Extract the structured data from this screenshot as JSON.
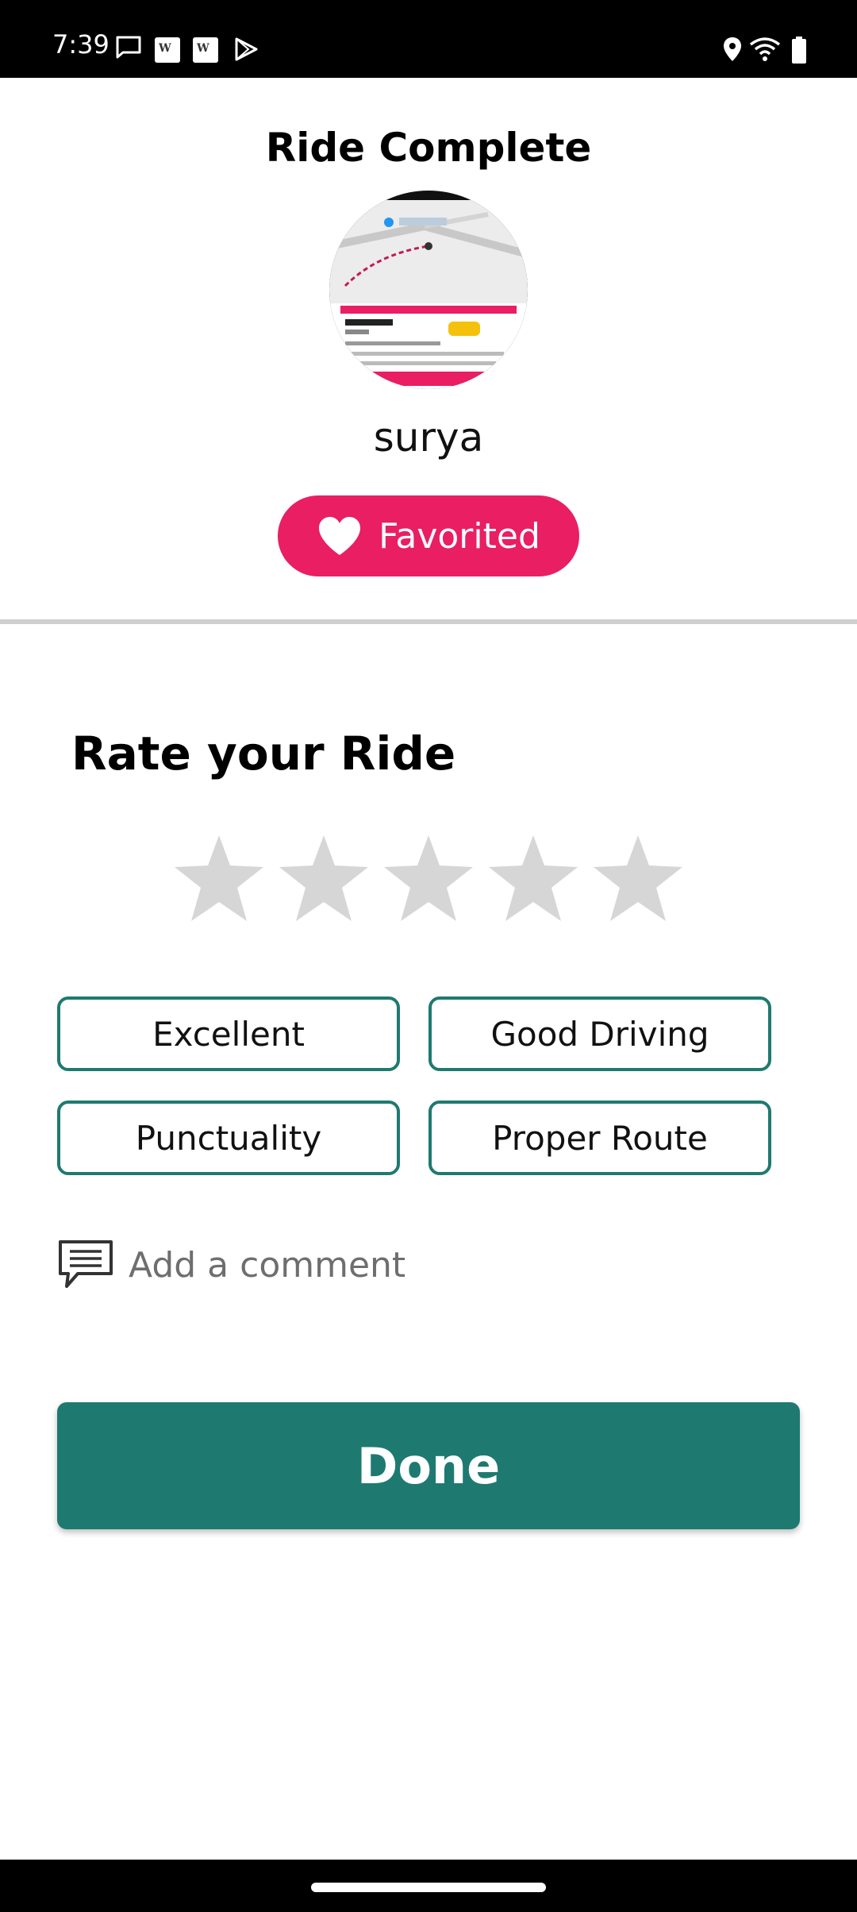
{
  "status_bar": {
    "time": "7:39",
    "icons": [
      "chat-icon",
      "news-icon",
      "news-icon",
      "play-store-icon",
      "location-icon",
      "wifi-icon",
      "battery-icon"
    ],
    "news_glyph": "W"
  },
  "header": {
    "title": "Ride Complete",
    "driver_name": "surya",
    "favorite_button_label": "Favorited"
  },
  "rating": {
    "title": "Rate your Ride",
    "stars_total": 5,
    "stars_selected": 0,
    "tags": [
      "Excellent",
      "Good Driving",
      "Punctuality",
      "Proper Route"
    ]
  },
  "comment": {
    "placeholder": "Add a comment"
  },
  "actions": {
    "done_label": "Done"
  },
  "colors": {
    "accent": "#1e7a70",
    "favorite": "#e91e63",
    "star_empty": "#d6d6d6",
    "divider": "#cfcfcf"
  }
}
